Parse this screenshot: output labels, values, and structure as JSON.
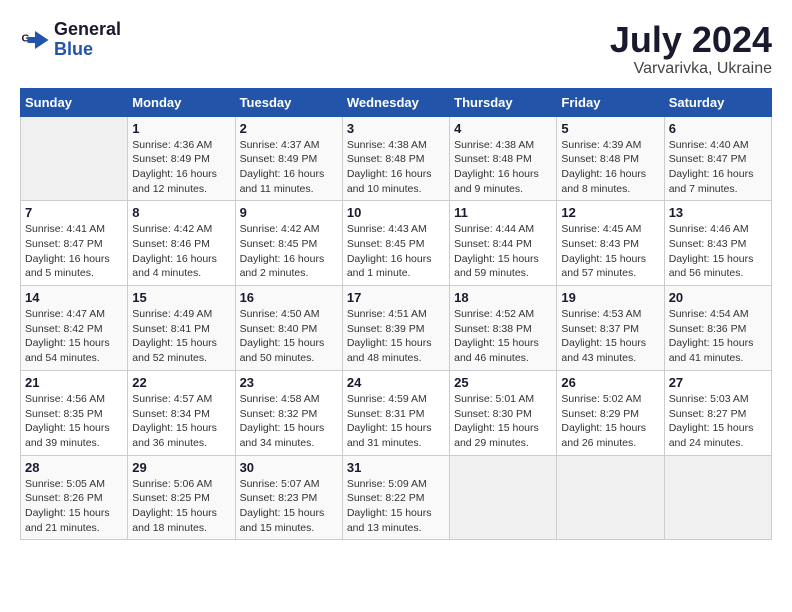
{
  "logo": {
    "general": "General",
    "blue": "Blue"
  },
  "title": "July 2024",
  "subtitle": "Varvarivka, Ukraine",
  "weekdays": [
    "Sunday",
    "Monday",
    "Tuesday",
    "Wednesday",
    "Thursday",
    "Friday",
    "Saturday"
  ],
  "weeks": [
    [
      {
        "day": "",
        "sunrise": "",
        "sunset": "",
        "daylight": ""
      },
      {
        "day": "1",
        "sunrise": "Sunrise: 4:36 AM",
        "sunset": "Sunset: 8:49 PM",
        "daylight": "Daylight: 16 hours and 12 minutes."
      },
      {
        "day": "2",
        "sunrise": "Sunrise: 4:37 AM",
        "sunset": "Sunset: 8:49 PM",
        "daylight": "Daylight: 16 hours and 11 minutes."
      },
      {
        "day": "3",
        "sunrise": "Sunrise: 4:38 AM",
        "sunset": "Sunset: 8:48 PM",
        "daylight": "Daylight: 16 hours and 10 minutes."
      },
      {
        "day": "4",
        "sunrise": "Sunrise: 4:38 AM",
        "sunset": "Sunset: 8:48 PM",
        "daylight": "Daylight: 16 hours and 9 minutes."
      },
      {
        "day": "5",
        "sunrise": "Sunrise: 4:39 AM",
        "sunset": "Sunset: 8:48 PM",
        "daylight": "Daylight: 16 hours and 8 minutes."
      },
      {
        "day": "6",
        "sunrise": "Sunrise: 4:40 AM",
        "sunset": "Sunset: 8:47 PM",
        "daylight": "Daylight: 16 hours and 7 minutes."
      }
    ],
    [
      {
        "day": "7",
        "sunrise": "Sunrise: 4:41 AM",
        "sunset": "Sunset: 8:47 PM",
        "daylight": "Daylight: 16 hours and 5 minutes."
      },
      {
        "day": "8",
        "sunrise": "Sunrise: 4:42 AM",
        "sunset": "Sunset: 8:46 PM",
        "daylight": "Daylight: 16 hours and 4 minutes."
      },
      {
        "day": "9",
        "sunrise": "Sunrise: 4:42 AM",
        "sunset": "Sunset: 8:45 PM",
        "daylight": "Daylight: 16 hours and 2 minutes."
      },
      {
        "day": "10",
        "sunrise": "Sunrise: 4:43 AM",
        "sunset": "Sunset: 8:45 PM",
        "daylight": "Daylight: 16 hours and 1 minute."
      },
      {
        "day": "11",
        "sunrise": "Sunrise: 4:44 AM",
        "sunset": "Sunset: 8:44 PM",
        "daylight": "Daylight: 15 hours and 59 minutes."
      },
      {
        "day": "12",
        "sunrise": "Sunrise: 4:45 AM",
        "sunset": "Sunset: 8:43 PM",
        "daylight": "Daylight: 15 hours and 57 minutes."
      },
      {
        "day": "13",
        "sunrise": "Sunrise: 4:46 AM",
        "sunset": "Sunset: 8:43 PM",
        "daylight": "Daylight: 15 hours and 56 minutes."
      }
    ],
    [
      {
        "day": "14",
        "sunrise": "Sunrise: 4:47 AM",
        "sunset": "Sunset: 8:42 PM",
        "daylight": "Daylight: 15 hours and 54 minutes."
      },
      {
        "day": "15",
        "sunrise": "Sunrise: 4:49 AM",
        "sunset": "Sunset: 8:41 PM",
        "daylight": "Daylight: 15 hours and 52 minutes."
      },
      {
        "day": "16",
        "sunrise": "Sunrise: 4:50 AM",
        "sunset": "Sunset: 8:40 PM",
        "daylight": "Daylight: 15 hours and 50 minutes."
      },
      {
        "day": "17",
        "sunrise": "Sunrise: 4:51 AM",
        "sunset": "Sunset: 8:39 PM",
        "daylight": "Daylight: 15 hours and 48 minutes."
      },
      {
        "day": "18",
        "sunrise": "Sunrise: 4:52 AM",
        "sunset": "Sunset: 8:38 PM",
        "daylight": "Daylight: 15 hours and 46 minutes."
      },
      {
        "day": "19",
        "sunrise": "Sunrise: 4:53 AM",
        "sunset": "Sunset: 8:37 PM",
        "daylight": "Daylight: 15 hours and 43 minutes."
      },
      {
        "day": "20",
        "sunrise": "Sunrise: 4:54 AM",
        "sunset": "Sunset: 8:36 PM",
        "daylight": "Daylight: 15 hours and 41 minutes."
      }
    ],
    [
      {
        "day": "21",
        "sunrise": "Sunrise: 4:56 AM",
        "sunset": "Sunset: 8:35 PM",
        "daylight": "Daylight: 15 hours and 39 minutes."
      },
      {
        "day": "22",
        "sunrise": "Sunrise: 4:57 AM",
        "sunset": "Sunset: 8:34 PM",
        "daylight": "Daylight: 15 hours and 36 minutes."
      },
      {
        "day": "23",
        "sunrise": "Sunrise: 4:58 AM",
        "sunset": "Sunset: 8:32 PM",
        "daylight": "Daylight: 15 hours and 34 minutes."
      },
      {
        "day": "24",
        "sunrise": "Sunrise: 4:59 AM",
        "sunset": "Sunset: 8:31 PM",
        "daylight": "Daylight: 15 hours and 31 minutes."
      },
      {
        "day": "25",
        "sunrise": "Sunrise: 5:01 AM",
        "sunset": "Sunset: 8:30 PM",
        "daylight": "Daylight: 15 hours and 29 minutes."
      },
      {
        "day": "26",
        "sunrise": "Sunrise: 5:02 AM",
        "sunset": "Sunset: 8:29 PM",
        "daylight": "Daylight: 15 hours and 26 minutes."
      },
      {
        "day": "27",
        "sunrise": "Sunrise: 5:03 AM",
        "sunset": "Sunset: 8:27 PM",
        "daylight": "Daylight: 15 hours and 24 minutes."
      }
    ],
    [
      {
        "day": "28",
        "sunrise": "Sunrise: 5:05 AM",
        "sunset": "Sunset: 8:26 PM",
        "daylight": "Daylight: 15 hours and 21 minutes."
      },
      {
        "day": "29",
        "sunrise": "Sunrise: 5:06 AM",
        "sunset": "Sunset: 8:25 PM",
        "daylight": "Daylight: 15 hours and 18 minutes."
      },
      {
        "day": "30",
        "sunrise": "Sunrise: 5:07 AM",
        "sunset": "Sunset: 8:23 PM",
        "daylight": "Daylight: 15 hours and 15 minutes."
      },
      {
        "day": "31",
        "sunrise": "Sunrise: 5:09 AM",
        "sunset": "Sunset: 8:22 PM",
        "daylight": "Daylight: 15 hours and 13 minutes."
      },
      {
        "day": "",
        "sunrise": "",
        "sunset": "",
        "daylight": ""
      },
      {
        "day": "",
        "sunrise": "",
        "sunset": "",
        "daylight": ""
      },
      {
        "day": "",
        "sunrise": "",
        "sunset": "",
        "daylight": ""
      }
    ]
  ]
}
